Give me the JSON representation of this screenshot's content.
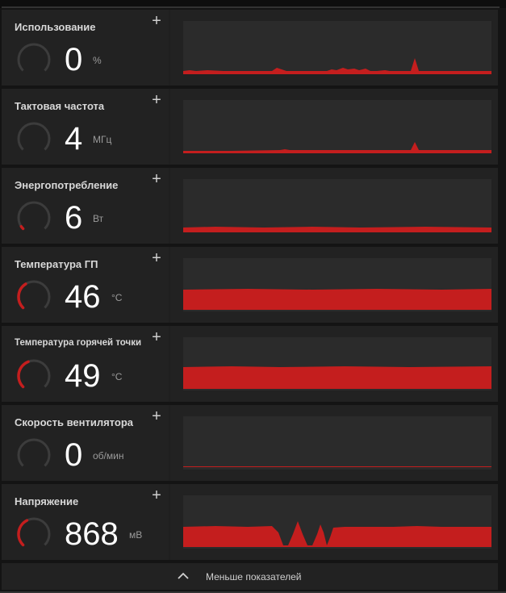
{
  "accent_color": "#c41e1e",
  "metrics": [
    {
      "label": "Использование",
      "value": "0",
      "unit": "%",
      "gauge_fraction": 0.0,
      "chart_shape": "usage-spikes"
    },
    {
      "label": "Тактовая частота",
      "value": "4",
      "unit": "МГц",
      "gauge_fraction": 0.0,
      "chart_shape": "clock-low"
    },
    {
      "label": "Энергопотребление",
      "value": "6",
      "unit": "Вт",
      "gauge_fraction": 0.04,
      "chart_shape": "power-low"
    },
    {
      "label": "Температура ГП",
      "value": "46",
      "unit": "°C",
      "gauge_fraction": 0.38,
      "chart_shape": "temp-flat"
    },
    {
      "label": "Температура горячей точки",
      "value": "49",
      "unit": "°C",
      "gauge_fraction": 0.42,
      "chart_shape": "hotspot-flat"
    },
    {
      "label": "Скорость вентилятора",
      "value": "0",
      "unit": "об/мин",
      "gauge_fraction": 0.0,
      "chart_shape": "fan-zero"
    },
    {
      "label": "Напряжение",
      "value": "868",
      "unit": "мВ",
      "gauge_fraction": 0.4,
      "chart_shape": "voltage-dips"
    }
  ],
  "icons": {
    "add": "plus-icon",
    "collapse": "chevron-up-icon"
  },
  "footer": {
    "label": "Меньше показателей"
  }
}
